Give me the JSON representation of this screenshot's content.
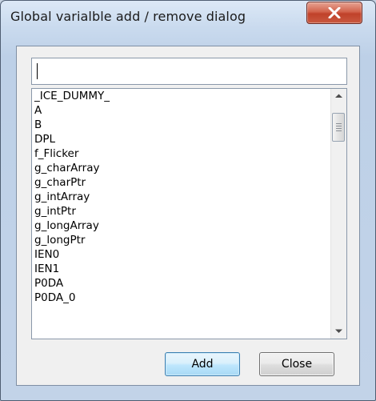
{
  "window": {
    "title": "Global varialble add / remove dialog",
    "close_glyph": "close-icon"
  },
  "search": {
    "value": "",
    "placeholder": ""
  },
  "variables": [
    "_ICE_DUMMY_",
    "A",
    "B",
    "DPL",
    "f_Flicker",
    "g_charArray",
    "g_charPtr",
    "g_intArray",
    "g_intPtr",
    "g_longArray",
    "g_longPtr",
    "IEN0",
    "IEN1",
    "P0DA",
    "P0DA_0"
  ],
  "buttons": {
    "add_label": "Add",
    "close_label": "Close"
  },
  "colors": {
    "close_button": "#c9452f",
    "default_button_border": "#3c7fb1",
    "window_frame": "#c9daee"
  }
}
